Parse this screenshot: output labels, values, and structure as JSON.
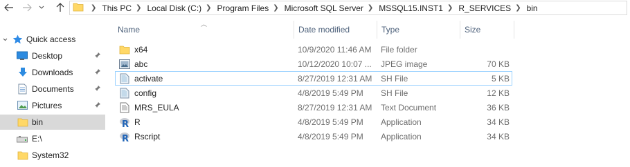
{
  "address": {
    "crumbs": [
      "This PC",
      "Local Disk (C:)",
      "Program Files",
      "Microsoft SQL Server",
      "MSSQL15.INST1",
      "R_SERVICES",
      "bin"
    ]
  },
  "nav": {
    "quick_access": "Quick access",
    "items": [
      {
        "label": "Desktop",
        "icon": "desktop-icon",
        "pinned": true
      },
      {
        "label": "Downloads",
        "icon": "download-icon",
        "pinned": true
      },
      {
        "label": "Documents",
        "icon": "documents-icon",
        "pinned": true
      },
      {
        "label": "Pictures",
        "icon": "pictures-icon",
        "pinned": true
      },
      {
        "label": "bin",
        "icon": "folder-icon",
        "pinned": false
      },
      {
        "label": "E:\\",
        "icon": "drive-icon",
        "pinned": false
      },
      {
        "label": "System32",
        "icon": "folder-icon",
        "pinned": false
      }
    ]
  },
  "columns": {
    "name": "Name",
    "date": "Date modified",
    "type": "Type",
    "size": "Size"
  },
  "files": [
    {
      "name": "x64",
      "date": "10/9/2020 11:46 AM",
      "type": "File folder",
      "size": "",
      "icon": "folder-icon"
    },
    {
      "name": "abc",
      "date": "10/12/2020 10:07 ...",
      "type": "JPEG image",
      "size": "70 KB",
      "icon": "image-icon"
    },
    {
      "name": "activate",
      "date": "8/27/2019 12:31 AM",
      "type": "SH File",
      "size": "5 KB",
      "icon": "sh-file-icon"
    },
    {
      "name": "config",
      "date": "4/8/2019 5:49 PM",
      "type": "SH File",
      "size": "12 KB",
      "icon": "sh-file-icon"
    },
    {
      "name": "MRS_EULA",
      "date": "8/27/2019 12:31 AM",
      "type": "Text Document",
      "size": "36 KB",
      "icon": "text-file-icon"
    },
    {
      "name": "R",
      "date": "4/8/2019 5:49 PM",
      "type": "Application",
      "size": "34 KB",
      "icon": "r-app-icon"
    },
    {
      "name": "Rscript",
      "date": "4/8/2019 5:49 PM",
      "type": "Application",
      "size": "34 KB",
      "icon": "r-app-icon"
    }
  ]
}
